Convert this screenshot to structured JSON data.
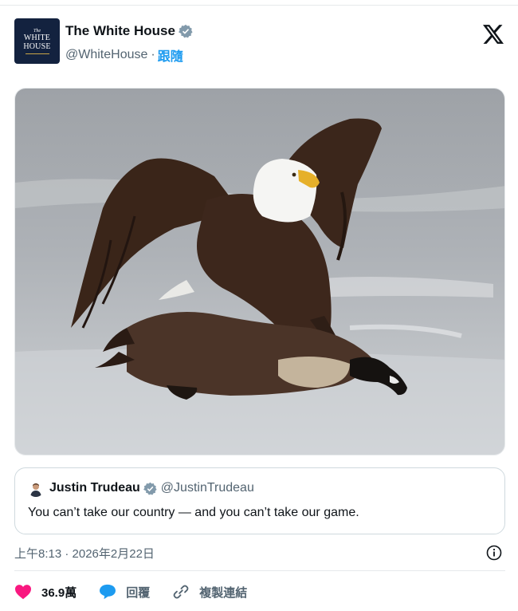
{
  "account": {
    "display_name": "The White House",
    "handle": "@WhiteHouse",
    "separator": "·",
    "follow_label": "跟隨",
    "avatar_text": {
      "line0": "The",
      "line1": "WHITE",
      "line2": "HOUSE"
    }
  },
  "photo": {
    "subject": "bald-eagle-standing-on-goose-on-ice"
  },
  "quoted_post": {
    "display_name": "Justin Trudeau",
    "handle": "@JustinTrudeau",
    "text": "You can’t take our country — and you can’t take our game."
  },
  "meta": {
    "timestamp": "上午8:13 · 2026年2月22日"
  },
  "actions": {
    "like_count": "36.9萬",
    "reply_label": "回覆",
    "copy_link_label": "複製連結"
  },
  "colors": {
    "verified": "#829aab",
    "like": "#f91880",
    "reply": "#1d9bf0",
    "link": "#1d9bf0",
    "avatar_bg": "#13223f"
  }
}
